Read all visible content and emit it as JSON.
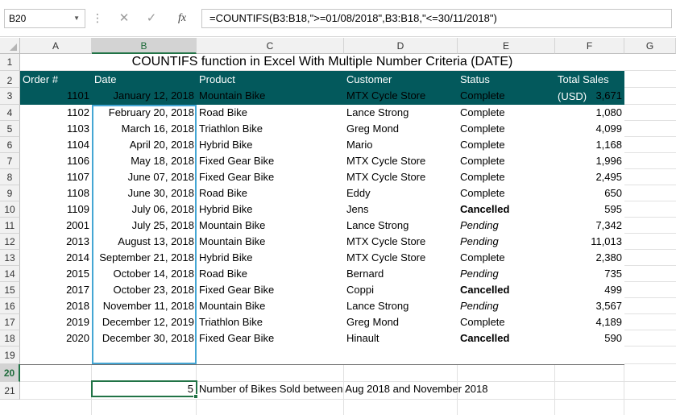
{
  "formula_bar": {
    "name_box": "B20",
    "formula": "=COUNTIFS(B3:B18,\">=01/08/2018\",B3:B18,\"<=30/11/2018\")",
    "fx_label": "fx",
    "cancel_glyph": "✕",
    "enter_glyph": "✓",
    "more_glyph": "⋮",
    "dropdown_glyph": "▼"
  },
  "columns": [
    "A",
    "B",
    "C",
    "D",
    "E",
    "F",
    "G"
  ],
  "rows": [
    "1",
    "2",
    "3",
    "4",
    "5",
    "6",
    "7",
    "8",
    "9",
    "10",
    "11",
    "12",
    "13",
    "14",
    "15",
    "16",
    "17",
    "18",
    "19",
    "20",
    "21"
  ],
  "sheet": {
    "title": "COUNTIFS function in Excel With Multiple Number Criteria (DATE)",
    "headers": {
      "order": "Order #",
      "date": "Date",
      "product": "Product",
      "customer": "Customer",
      "status": "Status",
      "sales_line1": "Total Sales",
      "sales_line2": "(USD)"
    },
    "records": [
      {
        "order": "1101",
        "date": "January 12, 2018",
        "product": "Mountain Bike",
        "customer": "MTX Cycle Store",
        "status": "Complete",
        "sales": "3,671"
      },
      {
        "order": "1102",
        "date": "February 20, 2018",
        "product": "Road Bike",
        "customer": "Lance Strong",
        "status": "Complete",
        "sales": "1,080"
      },
      {
        "order": "1103",
        "date": "March 16, 2018",
        "product": "Triathlon Bike",
        "customer": "Greg Mond",
        "status": "Complete",
        "sales": "4,099"
      },
      {
        "order": "1104",
        "date": "April 20, 2018",
        "product": "Hybrid Bike",
        "customer": "Mario",
        "status": "Complete",
        "sales": "1,168"
      },
      {
        "order": "1106",
        "date": "May 18, 2018",
        "product": "Fixed Gear Bike",
        "customer": "MTX Cycle Store",
        "status": "Complete",
        "sales": "1,996"
      },
      {
        "order": "1107",
        "date": "June 07, 2018",
        "product": "Fixed Gear Bike",
        "customer": "MTX Cycle Store",
        "status": "Complete",
        "sales": "2,495"
      },
      {
        "order": "1108",
        "date": "June 30, 2018",
        "product": "Road Bike",
        "customer": "Eddy",
        "status": "Complete",
        "sales": "650"
      },
      {
        "order": "1109",
        "date": "July 06, 2018",
        "product": "Hybrid Bike",
        "customer": "Jens",
        "status": "Cancelled",
        "sales": "595"
      },
      {
        "order": "2001",
        "date": "July 25, 2018",
        "product": "Mountain Bike",
        "customer": "Lance Strong",
        "status": "Pending",
        "sales": "7,342"
      },
      {
        "order": "2013",
        "date": "August 13, 2018",
        "product": "Mountain Bike",
        "customer": "MTX Cycle Store",
        "status": "Pending",
        "sales": "11,013"
      },
      {
        "order": "2014",
        "date": "September 21, 2018",
        "product": "Hybrid Bike",
        "customer": "MTX Cycle Store",
        "status": "Complete",
        "sales": "2,380"
      },
      {
        "order": "2015",
        "date": "October 14, 2018",
        "product": "Road Bike",
        "customer": "Bernard",
        "status": "Pending",
        "sales": "735"
      },
      {
        "order": "2017",
        "date": "October 23, 2018",
        "product": "Fixed Gear Bike",
        "customer": "Coppi",
        "status": "Cancelled",
        "sales": "499"
      },
      {
        "order": "2018",
        "date": "November 11, 2018",
        "product": "Mountain Bike",
        "customer": "Lance Strong",
        "status": "Pending",
        "sales": "3,567"
      },
      {
        "order": "2019",
        "date": "December 12, 2019",
        "product": "Triathlon Bike",
        "customer": "Greg Mond",
        "status": "Complete",
        "sales": "4,189"
      },
      {
        "order": "2020",
        "date": "December 30, 2018",
        "product": "Fixed Gear Bike",
        "customer": "Hinault",
        "status": "Cancelled",
        "sales": "590"
      }
    ],
    "result_value": "5",
    "result_label": "Number of  Bikes Sold between Aug 2018 and November 2018"
  },
  "colors": {
    "header_band": "#03595c",
    "selection_green": "#217346",
    "range_highlight": "#44a6d4"
  }
}
